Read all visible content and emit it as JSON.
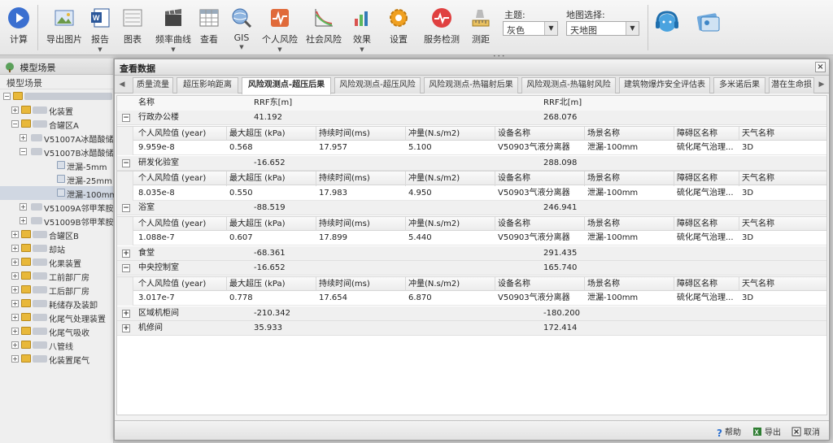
{
  "toolbar": {
    "buttons": [
      {
        "label": "计算"
      },
      {
        "label": "导出图片"
      },
      {
        "label": "报告"
      },
      {
        "label": "图表"
      },
      {
        "label": "频率曲线"
      },
      {
        "label": "查看"
      },
      {
        "label": "GIS"
      },
      {
        "label": "个人风险"
      },
      {
        "label": "社会风险"
      },
      {
        "label": "效果"
      },
      {
        "label": "设置"
      },
      {
        "label": "服务检测"
      },
      {
        "label": "测距"
      }
    ],
    "theme_label": "主题:",
    "theme_value": "灰色",
    "map_label": "地图选择:",
    "map_value": "天地图"
  },
  "left_panel": {
    "header": "模型场景",
    "subheader": "模型场景",
    "items": [
      {
        "text": "化装置"
      },
      {
        "text": "合罐区A"
      },
      {
        "text": "V51007A冰醋酸储"
      },
      {
        "text": "V51007B冰醋酸储"
      },
      {
        "text": "泄漏-5mm"
      },
      {
        "text": "泄漏-25mm"
      },
      {
        "text": "泄漏-100mm"
      },
      {
        "text": "V51009A邻甲苯胺"
      },
      {
        "text": "V51009B邻甲苯胺"
      },
      {
        "text": "合罐区B"
      },
      {
        "text": "却站"
      },
      {
        "text": "化果装置"
      },
      {
        "text": "工前部厂房"
      },
      {
        "text": "工后部厂房"
      },
      {
        "text": "耗储存及装卸"
      },
      {
        "text": "化尾气处理装置"
      },
      {
        "text": "化尾气吸收"
      },
      {
        "text": "八管线"
      },
      {
        "text": "化装置尾气"
      }
    ]
  },
  "dialog": {
    "title": "查看数据",
    "tabs": [
      {
        "label": "质量流量"
      },
      {
        "label": "超压影响距离"
      },
      {
        "label": "风险观测点-超压后果"
      },
      {
        "label": "风险观测点-超压风险"
      },
      {
        "label": "风险观测点-热辐射后果"
      },
      {
        "label": "风险观测点-热辐射风险"
      },
      {
        "label": "建筑物爆炸安全评估表"
      },
      {
        "label": "多米诺后果"
      },
      {
        "label": "潜在生命损"
      }
    ],
    "columns": {
      "name": "名称",
      "east": "RRF东[m]",
      "north": "RRF北[m]"
    },
    "subcolumns": [
      "个人风险值 (year)",
      "最大超压 (kPa)",
      "持续时间(ms)",
      "冲量(N.s/m2)",
      "设备名称",
      "场景名称",
      "障碍区名称",
      "天气名称"
    ],
    "rows": [
      {
        "name": "行政办公楼",
        "east": "41.192",
        "north": "268.076",
        "expanded": "−",
        "detail": [
          "9.959e-8",
          "0.568",
          "17.957",
          "5.100",
          "V50903气液分离器",
          "泄漏-100mm",
          "硫化尾气治理...",
          "3D"
        ]
      },
      {
        "name": "研发化验室",
        "east": "-16.652",
        "north": "288.098",
        "expanded": "−",
        "detail": [
          "8.035e-8",
          "0.550",
          "17.983",
          "4.950",
          "V50903气液分离器",
          "泄漏-100mm",
          "硫化尾气治理...",
          "3D"
        ]
      },
      {
        "name": "浴室",
        "east": "-88.519",
        "north": "246.941",
        "expanded": "−",
        "detail": [
          "1.088e-7",
          "0.607",
          "17.899",
          "5.440",
          "V50903气液分离器",
          "泄漏-100mm",
          "硫化尾气治理...",
          "3D"
        ]
      },
      {
        "name": "食堂",
        "east": "-68.361",
        "north": "291.435",
        "expanded": "+"
      },
      {
        "name": "中央控制室",
        "east": "-16.652",
        "north": "165.740",
        "expanded": "−",
        "detail": [
          "3.017e-7",
          "0.778",
          "17.654",
          "6.870",
          "V50903气液分离器",
          "泄漏-100mm",
          "硫化尾气治理...",
          "3D"
        ]
      },
      {
        "name": "区域机柜间",
        "east": "-210.342",
        "north": "-180.200",
        "expanded": "+"
      },
      {
        "name": "机修间",
        "east": "35.933",
        "north": "172.414",
        "expanded": "+"
      }
    ],
    "footer": {
      "help": "帮助",
      "export": "导出",
      "cancel": "取消"
    }
  },
  "colors": {
    "accent": "#3a6fd0",
    "folder": "#e8b83a"
  }
}
